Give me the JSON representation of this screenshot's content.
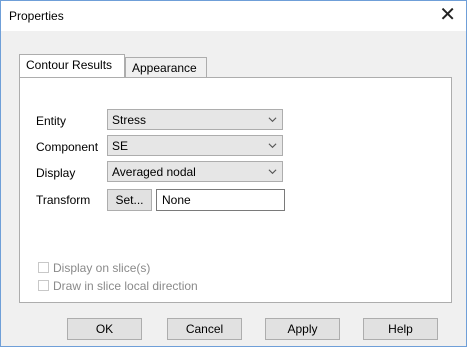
{
  "window": {
    "title": "Properties"
  },
  "tabs": [
    {
      "label": "Contour Results",
      "active": true
    },
    {
      "label": "Appearance",
      "active": false
    }
  ],
  "form": {
    "entity": {
      "label": "Entity",
      "value": "Stress"
    },
    "component": {
      "label": "Component",
      "value": "SE"
    },
    "display": {
      "label": "Display",
      "value": "Averaged nodal"
    },
    "transform": {
      "label": "Transform",
      "button": "Set...",
      "value": "None"
    }
  },
  "options": {
    "display_on_slice": {
      "label": "Display on slice(s)",
      "checked": false,
      "enabled": false
    },
    "draw_in_slice_local": {
      "label": "Draw in slice local direction",
      "checked": false,
      "enabled": false
    }
  },
  "buttons": {
    "ok": "OK",
    "cancel": "Cancel",
    "apply": "Apply",
    "help": "Help"
  }
}
